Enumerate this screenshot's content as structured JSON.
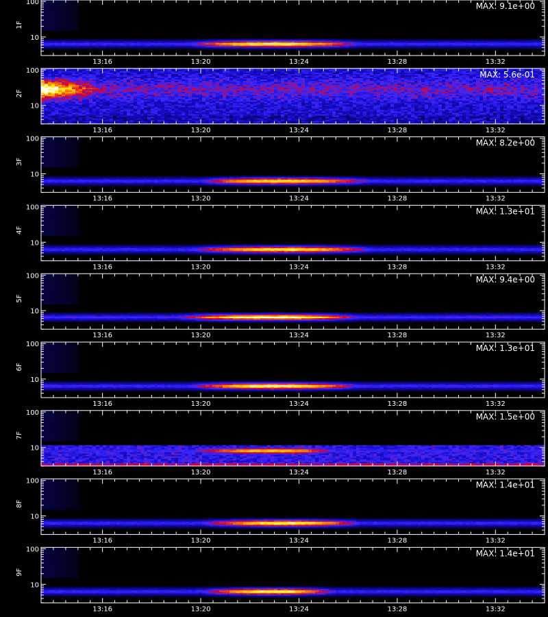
{
  "chart_data": {
    "type": "heatmap",
    "x_range": [
      "13:13:30",
      "13:34:00"
    ],
    "x_ticks": [
      "13:16",
      "13:20",
      "13:24",
      "13:28",
      "13:32"
    ],
    "y_scale": "log",
    "y_range": [
      3,
      110
    ],
    "y_ticks": [
      "10",
      "100"
    ],
    "xlabel": "",
    "panels": [
      {
        "label": "1F",
        "max_text": "MAX: 9.1e+00",
        "kind": "band",
        "band_y": 6.3,
        "peak_start": "13:19:30",
        "peak_end": "13:26:30",
        "peak_center": "13:23:00",
        "peak_level": 1.0
      },
      {
        "label": "2F",
        "max_text": "MAX: 5.6e-01",
        "kind": "noise",
        "band_y": 28,
        "peak_start": "13:13:30",
        "peak_end": "13:16:00",
        "peak_center": "13:13:40",
        "peak_level": 0.85
      },
      {
        "label": "3F",
        "max_text": "MAX: 8.2e+00",
        "kind": "band",
        "band_y": 6.2,
        "peak_start": "13:20:00",
        "peak_end": "13:27:00",
        "peak_center": "13:23:00",
        "peak_level": 0.95
      },
      {
        "label": "4F",
        "max_text": "MAX: 1.3e+01",
        "kind": "band",
        "band_y": 6.2,
        "peak_start": "13:19:30",
        "peak_end": "13:27:00",
        "peak_center": "13:23:30",
        "peak_level": 0.95
      },
      {
        "label": "5F",
        "max_text": "MAX: 9.4e+00",
        "kind": "band",
        "band_y": 6.5,
        "peak_start": "13:19:00",
        "peak_end": "13:26:30",
        "peak_center": "13:23:00",
        "peak_level": 1.0
      },
      {
        "label": "6F",
        "max_text": "MAX: 1.3e+01",
        "kind": "band",
        "band_y": 6.3,
        "peak_start": "13:19:30",
        "peak_end": "13:26:30",
        "peak_center": "13:23:00",
        "peak_level": 1.0
      },
      {
        "label": "7F",
        "max_text": "MAX: 1.5e+00",
        "kind": "band_noisy",
        "band_y": 8.0,
        "peak_start": "13:19:30",
        "peak_end": "13:25:30",
        "peak_center": "13:23:00",
        "peak_level": 0.85
      },
      {
        "label": "8F",
        "max_text": "MAX: 1.4e+01",
        "kind": "band",
        "band_y": 6.2,
        "peak_start": "13:20:00",
        "peak_end": "13:26:30",
        "peak_center": "13:23:30",
        "peak_level": 1.0
      },
      {
        "label": "9F",
        "max_text": "MAX: 1.4e+01",
        "kind": "band",
        "band_y": 6.2,
        "peak_start": "13:20:00",
        "peak_end": "13:25:30",
        "peak_center": "13:23:00",
        "peak_level": 1.0
      }
    ]
  }
}
